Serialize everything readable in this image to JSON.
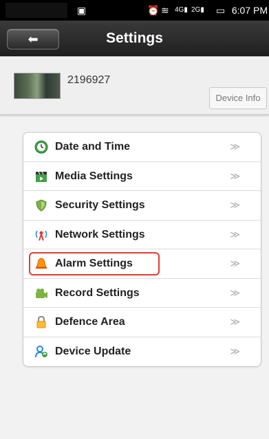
{
  "status_bar": {
    "time": "6:07 PM"
  },
  "header": {
    "title": "Settings",
    "back_icon": "back-arrow-icon"
  },
  "device": {
    "id": "2196927",
    "info_button": "Device Info"
  },
  "menu": [
    {
      "label": "Date and Time",
      "icon": "clock-icon",
      "chevron": "≫",
      "color": "#4caf50"
    },
    {
      "label": "Media Settings",
      "icon": "clapperboard-icon",
      "chevron": "≫",
      "color": "#43a047"
    },
    {
      "label": "Security Settings",
      "icon": "shield-icon",
      "chevron": "≫",
      "color": "#8bc34a"
    },
    {
      "label": "Network Settings",
      "icon": "antenna-icon",
      "chevron": "≫",
      "color": "#e53935"
    },
    {
      "label": "Alarm Settings",
      "icon": "bell-icon",
      "chevron": "≫",
      "color": "#ff9800"
    },
    {
      "label": "Record Settings",
      "icon": "camera-icon",
      "chevron": "≫",
      "color": "#7cb342"
    },
    {
      "label": "Defence Area",
      "icon": "lock-icon",
      "chevron": "≫",
      "color": "#fbc02d"
    },
    {
      "label": "Device Update",
      "icon": "user-update-icon",
      "chevron": "≫",
      "color": "#1e88e5"
    }
  ],
  "highlighted_item": "Alarm Settings",
  "highlight_color": "#e53935"
}
